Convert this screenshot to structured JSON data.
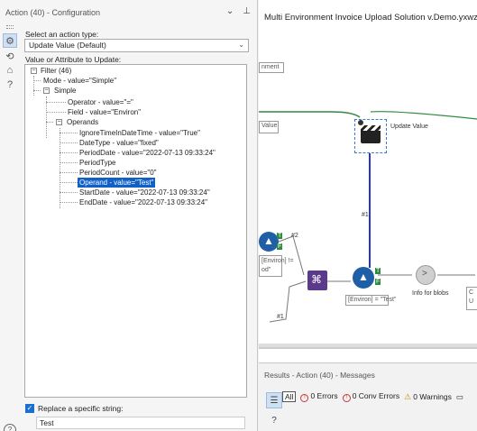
{
  "config": {
    "header_title": "Action (40) - Configuration",
    "action_type_label": "Select an action type:",
    "action_type_value": "Update Value (Default)",
    "value_label": "Value or Attribute to Update:",
    "tree": {
      "filter": "Filter (46)",
      "mode": "Mode - value=\"Simple\"",
      "simple": "Simple",
      "operator": "Operator - value=\"=\"",
      "field": "Field - value=\"Environ\"",
      "operands": "Operands",
      "ignore_time": "IgnoreTimeInDateTime - value=\"True\"",
      "date_type": "DateType - value=\"fixed\"",
      "period_date": "PeriodDate - value=\"2022-07-13 09:33:24\"",
      "period_type": "PeriodType",
      "period_count": "PeriodCount - value=\"0\"",
      "operand": "Operand - value=\"Test\"",
      "start_date": "StartDate - value=\"2022-07-13 09:33:24\"",
      "end_date": "EndDate - value=\"2022-07-13 09:33:24\""
    },
    "replace_label": "Replace a specific string:",
    "replace_value": "Test",
    "replace_checked": true
  },
  "canvas": {
    "title": "Multi Environment Invoice Upload Solution v.Demo.yxwz*",
    "labels": {
      "comment_top": "nment",
      "value_left": "Value",
      "update_value": "Update Value",
      "link_1": "#1",
      "link_2": "#2",
      "link_3": "#1",
      "environ_left": "[Environ] !=",
      "environ_left2": "od\"",
      "environ_filter": "[Environ] = \"Test\"",
      "info_blobs": "Info for blobs",
      "right_box1": "C",
      "right_box2": "U"
    },
    "colors": {
      "connection_green": "#2e8b3e",
      "connection_blue": "#2a36c8",
      "filter_blue": "#1f5fa8",
      "formula_purple": "#5b3a8c",
      "selection_dash": "#3a7bd5"
    }
  },
  "results": {
    "title": "Results - Action (40) - Messages",
    "all_label": "All",
    "errors": "0 Errors",
    "conv_errors": "0 Conv Errors",
    "warnings": "0 Warnings"
  }
}
